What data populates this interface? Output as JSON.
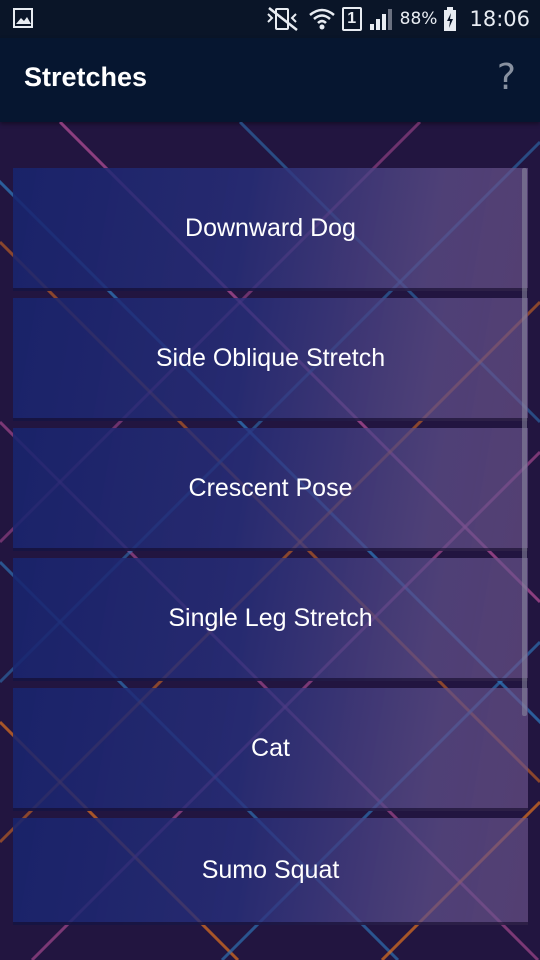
{
  "status_bar": {
    "battery_percent": "88%",
    "sim_slot": "1",
    "time": "18:06",
    "icons": [
      "image-icon",
      "mute-vibrate-icon",
      "wifi-icon",
      "sim-icon",
      "signal-icon",
      "battery-charging-icon"
    ]
  },
  "app_bar": {
    "title": "Stretches",
    "help_label": "?"
  },
  "stretches": [
    {
      "label": "Downward Dog"
    },
    {
      "label": "Side Oblique Stretch"
    },
    {
      "label": "Crescent Pose"
    },
    {
      "label": "Single Leg Stretch"
    },
    {
      "label": "Cat"
    },
    {
      "label": "Sumo Squat"
    }
  ],
  "colors": {
    "status_bar_bg": "#0a1528",
    "app_bar_bg": "#061630",
    "page_bg": "#221540",
    "line_blue": "#2e6fb0",
    "line_pink": "#b8509a",
    "line_orange": "#e0701e"
  }
}
